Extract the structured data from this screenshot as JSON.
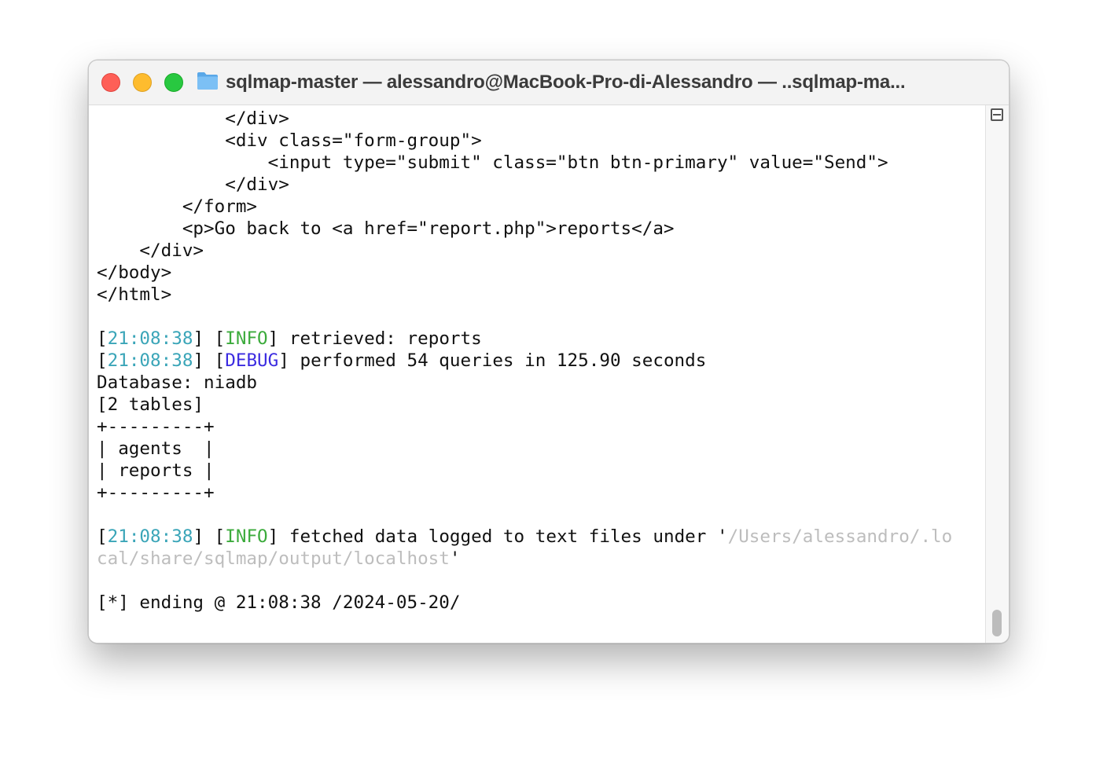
{
  "window": {
    "title": "sqlmap-master — alessandro@MacBook-Pro-di-Alessandro — ..sqlmap-ma..."
  },
  "terminal": {
    "lines": [
      [
        {
          "t": "            </div>"
        }
      ],
      [
        {
          "t": "            <div class=\"form-group\">"
        }
      ],
      [
        {
          "t": "                <input type=\"submit\" class=\"btn btn-primary\" value=\"Send\">"
        }
      ],
      [
        {
          "t": "            </div>"
        }
      ],
      [
        {
          "t": "        </form>"
        }
      ],
      [
        {
          "t": "        <p>Go back to <a href=\"report.php\">reports</a>"
        }
      ],
      [
        {
          "t": "    </div>"
        }
      ],
      [
        {
          "t": "</body>"
        }
      ],
      [
        {
          "t": "</html>"
        }
      ],
      [
        {
          "t": ""
        }
      ],
      [
        {
          "t": "["
        },
        {
          "t": "21:08:38",
          "c": "ts"
        },
        {
          "t": "] ["
        },
        {
          "t": "INFO",
          "c": "lvl-info"
        },
        {
          "t": "] retrieved: reports"
        }
      ],
      [
        {
          "t": "["
        },
        {
          "t": "21:08:38",
          "c": "ts"
        },
        {
          "t": "] ["
        },
        {
          "t": "DEBUG",
          "c": "lvl-debug"
        },
        {
          "t": "] performed 54 queries in 125.90 seconds"
        }
      ],
      [
        {
          "t": "Database: niadb"
        }
      ],
      [
        {
          "t": "[2 tables]"
        }
      ],
      [
        {
          "t": "+---------+"
        }
      ],
      [
        {
          "t": "| agents  |"
        }
      ],
      [
        {
          "t": "| reports |"
        }
      ],
      [
        {
          "t": "+---------+"
        }
      ],
      [
        {
          "t": ""
        }
      ],
      [
        {
          "t": "["
        },
        {
          "t": "21:08:38",
          "c": "ts"
        },
        {
          "t": "] ["
        },
        {
          "t": "INFO",
          "c": "lvl-info"
        },
        {
          "t": "] fetched data logged to text files under '"
        },
        {
          "t": "/Users/alessandro/.lo",
          "c": "path"
        }
      ],
      [
        {
          "t": "cal/share/sqlmap/output/localhost",
          "c": "path"
        },
        {
          "t": "'"
        }
      ],
      [
        {
          "t": ""
        }
      ],
      [
        {
          "t": "[*] ending @ 21:08:38 /2024-05-20/"
        }
      ]
    ]
  },
  "colors": {
    "timestamp": "#3aa5b8",
    "info": "#3cab3c",
    "debug": "#3b2be0",
    "path": "#bdbdbd",
    "close": "#fe5f57",
    "minimize": "#febc2e",
    "maximize": "#28c840"
  },
  "icons": {
    "folder": "folder-icon",
    "split": "split-pane-icon"
  }
}
